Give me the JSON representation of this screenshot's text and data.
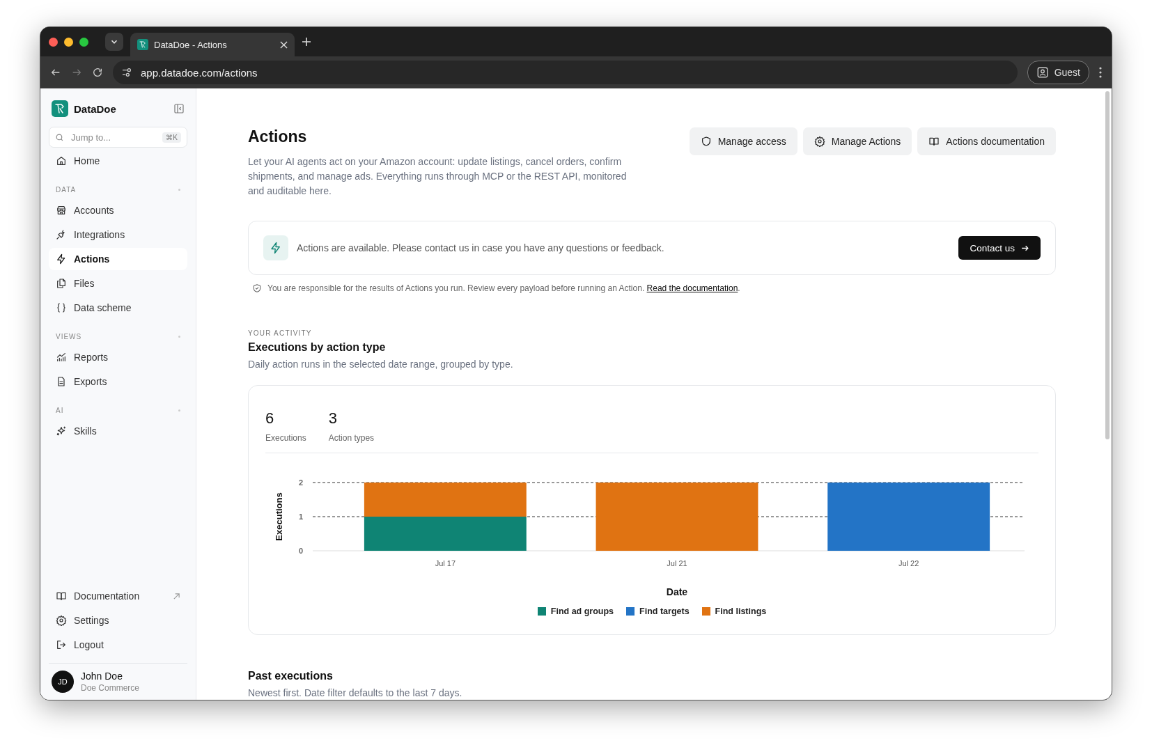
{
  "browser": {
    "tab_title": "DataDoe - Actions",
    "url": "app.datadoe.com/actions",
    "profile": "Guest"
  },
  "sidebar": {
    "brand": "DataDoe",
    "search": {
      "placeholder": "Jump to...",
      "shortcut": "⌘K"
    },
    "top_items": [
      {
        "label": "Home",
        "selected": false
      }
    ],
    "sections": [
      {
        "heading": "DATA",
        "items": [
          {
            "label": "Accounts",
            "selected": false
          },
          {
            "label": "Integrations",
            "selected": false
          },
          {
            "label": "Actions",
            "selected": true
          },
          {
            "label": "Files",
            "selected": false
          },
          {
            "label": "Data scheme",
            "selected": false
          }
        ]
      },
      {
        "heading": "VIEWS",
        "items": [
          {
            "label": "Reports",
            "selected": false
          },
          {
            "label": "Exports",
            "selected": false
          }
        ]
      },
      {
        "heading": "AI",
        "items": [
          {
            "label": "Skills",
            "selected": false
          }
        ]
      }
    ],
    "bottom_items": [
      {
        "label": "Documentation",
        "external": true
      },
      {
        "label": "Settings",
        "external": false
      },
      {
        "label": "Logout",
        "external": false
      }
    ],
    "user": {
      "initials": "JD",
      "name": "John Doe",
      "company": "Doe Commerce"
    }
  },
  "page": {
    "title": "Actions",
    "description": "Let your AI agents act on your Amazon account: update listings, cancel orders, confirm shipments, and manage ads. Everything runs through MCP or the REST API, monitored and auditable here.",
    "buttons": [
      "Manage access",
      "Manage Actions",
      "Actions documentation"
    ]
  },
  "banner": {
    "text": "Actions are available. Please contact us in case you have any questions or feedback.",
    "button": "Contact us"
  },
  "notice": {
    "text": "You are responsible for the results of Actions you run. Review every payload before running an Action.",
    "link": "Read the documentation",
    "after": "."
  },
  "activity": {
    "eyebrow": "YOUR ACTIVITY",
    "title": "Executions by action type",
    "subtitle": "Daily action runs in the selected date range, grouped by type.",
    "stats": [
      {
        "value": "6",
        "label": "Executions"
      },
      {
        "value": "3",
        "label": "Action types"
      }
    ],
    "chart_data": {
      "type": "bar",
      "stacked": true,
      "xlabel": "Date",
      "ylabel": "Executions",
      "categories": [
        "Jul 17",
        "Jul 21",
        "Jul 22"
      ],
      "yticks": [
        0,
        1,
        2
      ],
      "ylim": [
        0,
        2
      ],
      "series": [
        {
          "name": "Find ad groups",
          "color": "#0f8474",
          "values": [
            1,
            0,
            0
          ]
        },
        {
          "name": "Find targets",
          "color": "#2374c6",
          "values": [
            0,
            0,
            2
          ]
        },
        {
          "name": "Find listings",
          "color": "#e07312",
          "values": [
            1,
            2,
            0
          ]
        }
      ]
    }
  },
  "past": {
    "title": "Past executions",
    "subtitle": "Newest first. Date filter defaults to the last 7 days."
  }
}
